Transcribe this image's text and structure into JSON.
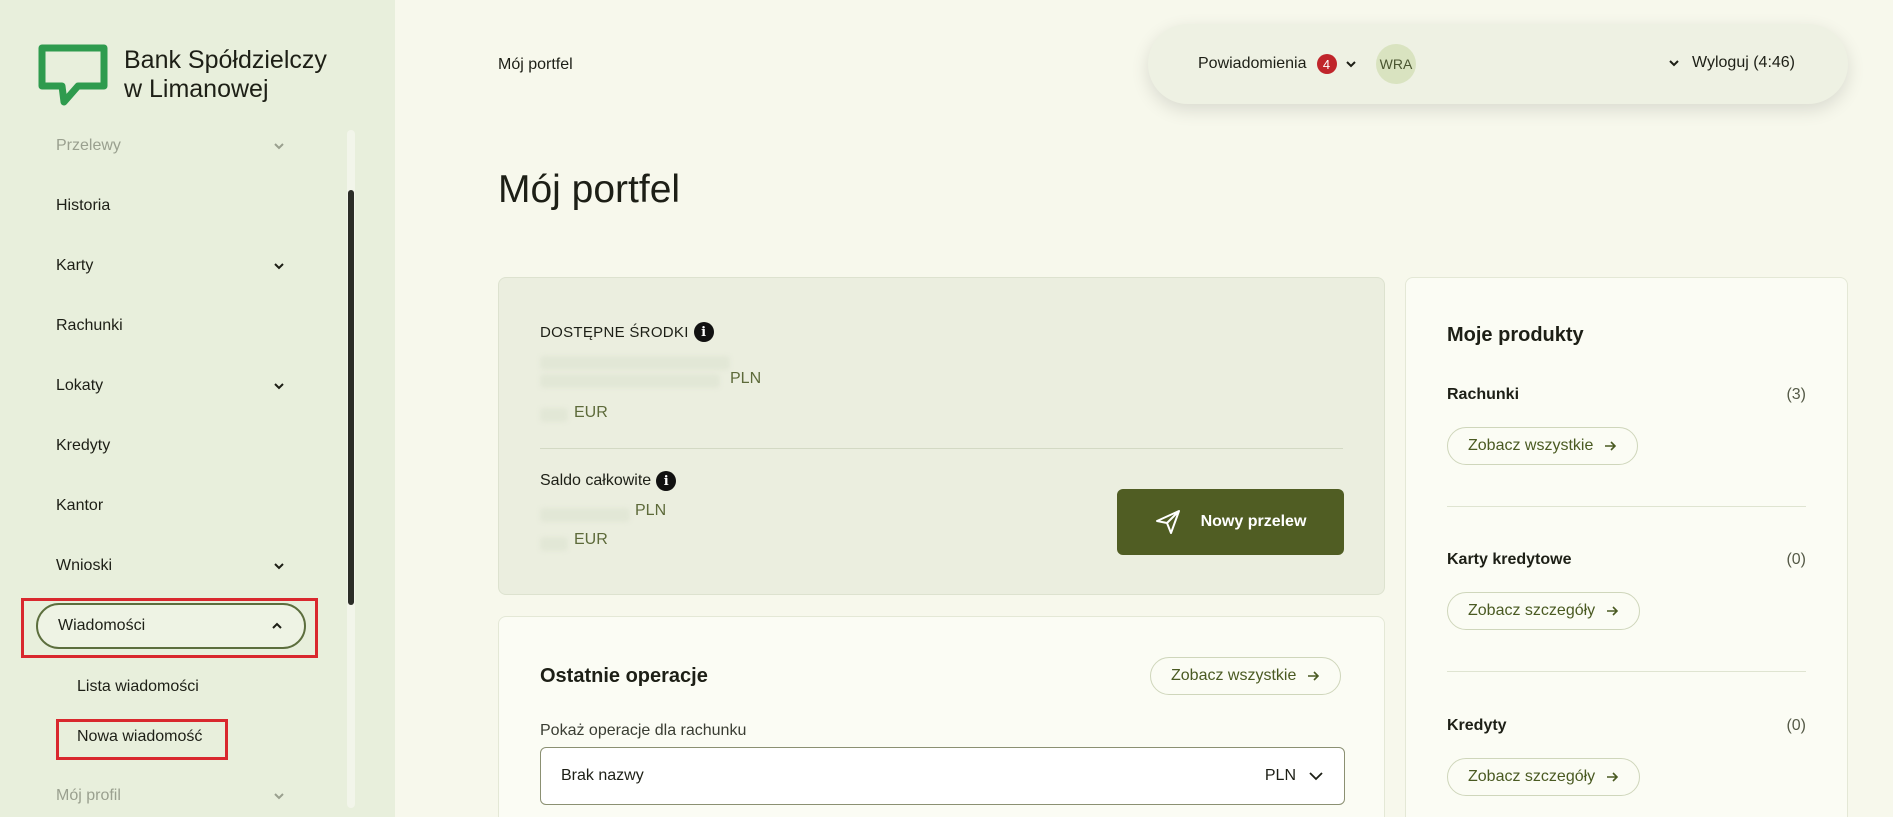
{
  "logo": {
    "line1": "Bank Spółdzielczy",
    "line2": "w Limanowej",
    "color": "#2e9b4e"
  },
  "sidebar": {
    "items": [
      {
        "label": "Przelewy",
        "chevron": "down",
        "faded": true
      },
      {
        "label": "Historia"
      },
      {
        "label": "Karty",
        "chevron": "down"
      },
      {
        "label": "Rachunki"
      },
      {
        "label": "Lokaty",
        "chevron": "down"
      },
      {
        "label": "Kredyty"
      },
      {
        "label": "Kantor"
      },
      {
        "label": "Wnioski",
        "chevron": "down"
      },
      {
        "label": "Wiadomości",
        "chevron": "up",
        "active": true
      },
      {
        "label": "Mój profil",
        "chevron": "down",
        "faded": true
      }
    ],
    "sub_items": [
      {
        "label": "Lista wiadomości"
      },
      {
        "label": "Nowa wiadomość"
      }
    ]
  },
  "header": {
    "breadcrumb": "Mój portfel",
    "notifications_label": "Powiadomienia",
    "notifications_count": "4",
    "avatar_initials": "WRA",
    "logout_label": "Wyloguj (4:46)"
  },
  "page_title": "Mój portfel",
  "funds": {
    "available_label": "DOSTĘPNE ŚRODKI",
    "available_currencies": [
      "PLN",
      "EUR"
    ],
    "saldo_label": "Saldo całkowite",
    "saldo_currencies": [
      "PLN",
      "EUR"
    ],
    "transfer_button": "Nowy przelew"
  },
  "operations": {
    "title": "Ostatnie operacje",
    "see_all": "Zobacz wszystkie",
    "account_label": "Pokaż operacje dla rachunku",
    "account_value": "Brak nazwy",
    "account_currency": "PLN"
  },
  "products": {
    "title": "Moje produkty",
    "items": [
      {
        "name": "Rachunki",
        "count": "(3)",
        "action": "Zobacz wszystkie"
      },
      {
        "name": "Karty kredytowe",
        "count": "(0)",
        "action": "Zobacz szczegóły"
      },
      {
        "name": "Kredyty",
        "count": "(0)",
        "action": "Zobacz szczegóły"
      }
    ]
  },
  "colors": {
    "accent": "#505d23",
    "highlight": "#d9282e",
    "badge": "#c0252b"
  }
}
